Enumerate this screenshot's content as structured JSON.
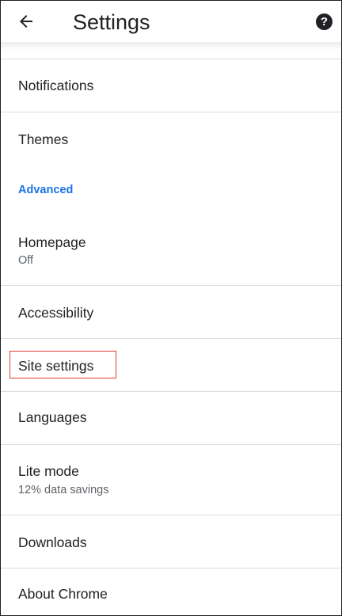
{
  "header": {
    "title": "Settings",
    "back_icon": "arrow-left-icon",
    "help_icon": "help-icon",
    "help_glyph": "?"
  },
  "items": {
    "notifications": {
      "title": "Notifications"
    },
    "themes": {
      "title": "Themes"
    },
    "advanced_header": "Advanced",
    "homepage": {
      "title": "Homepage",
      "subtitle": "Off"
    },
    "accessibility": {
      "title": "Accessibility"
    },
    "site_settings": {
      "title": "Site settings"
    },
    "languages": {
      "title": "Languages"
    },
    "lite_mode": {
      "title": "Lite mode",
      "subtitle": "12% data savings"
    },
    "downloads": {
      "title": "Downloads"
    },
    "about_chrome": {
      "title": "About Chrome"
    }
  },
  "colors": {
    "accent": "#1a73e8",
    "highlight": "#e53935",
    "divider": "#dadce0"
  }
}
